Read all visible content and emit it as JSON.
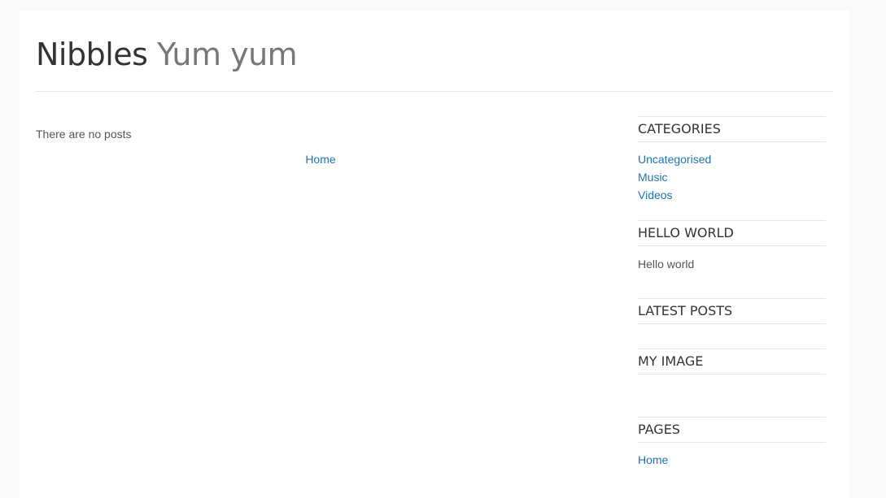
{
  "header": {
    "site_name": "Nibbles",
    "tagline": "Yum yum"
  },
  "content": {
    "empty_message": "There are no posts",
    "home_link": "Home"
  },
  "sidebar": {
    "categories": {
      "title": "CATEGORIES",
      "items": [
        "Uncategorised",
        "Music",
        "Videos"
      ]
    },
    "hello_world": {
      "title": "HELLO WORLD",
      "text": "Hello world"
    },
    "latest_posts": {
      "title": "LATEST POSTS"
    },
    "my_image": {
      "title": "MY IMAGE"
    },
    "pages": {
      "title": "PAGES",
      "items": [
        "Home"
      ]
    }
  },
  "colors": {
    "link": "#1e73be",
    "text": "#444444",
    "background": "#f9f9f9"
  }
}
